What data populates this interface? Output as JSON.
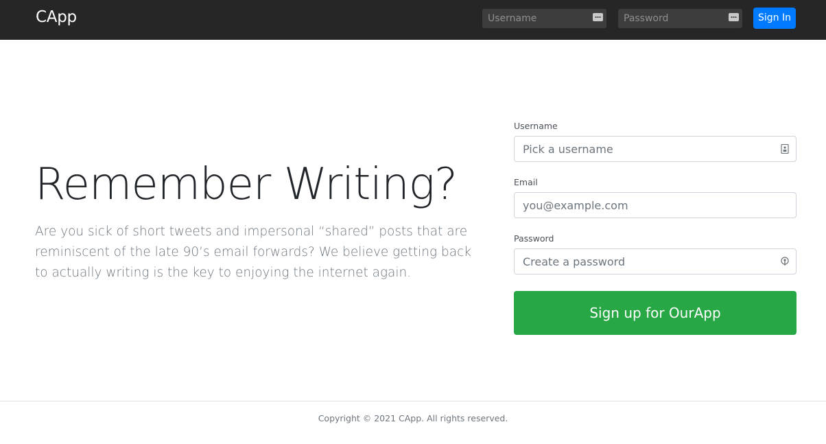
{
  "header": {
    "brand": "CApp",
    "username_placeholder": "Username",
    "password_placeholder": "Password",
    "signin_label": "Sign In"
  },
  "hero": {
    "title": "Remember Writing?",
    "text": "Are you sick of short tweets and impersonal “shared” posts that are reminiscent of the late 90’s email forwards? We believe getting back to actually writing is the key to enjoying the internet again."
  },
  "signup_form": {
    "username_label": "Username",
    "username_placeholder": "Pick a username",
    "email_label": "Email",
    "email_placeholder": "you@example.com",
    "password_label": "Password",
    "password_placeholder": "Create a password",
    "submit_label": "Sign up for OurApp"
  },
  "footer": {
    "text": "Copyright © 2021 CApp. All rights reserved."
  },
  "colors": {
    "header_bg": "#262626",
    "primary": "#007bff",
    "success": "#28a745"
  },
  "icons": {
    "header_field_icon": "password-manager-icon",
    "username_field_icon": "contact-card-icon",
    "password_field_icon": "key-icon"
  }
}
